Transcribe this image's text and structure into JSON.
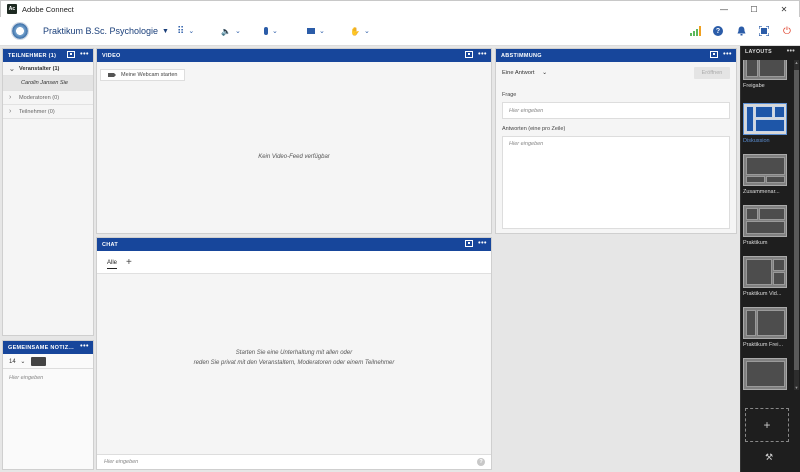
{
  "window": {
    "app_icon_text": "Ac",
    "title": "Adobe Connect",
    "controls": [
      "—",
      "☐",
      "✕"
    ]
  },
  "toolbar": {
    "room_title": "Praktikum B.Sc. Psychologie",
    "icons": {
      "apps": "⠿",
      "speaker": "🔈",
      "microphone": "🎤",
      "camera": "■",
      "hand": "✋"
    },
    "right_icons": {
      "connection": "▂▃▅▇",
      "help": "?",
      "notifications": "🔔",
      "fullscreen": "⛶",
      "power": "⏻"
    },
    "accent_color": "#2b5ca8"
  },
  "participants": {
    "header": "TEILNEHMER  (1)",
    "groups": [
      {
        "label": "Veranstalter (1)",
        "expanded": true
      },
      {
        "label": "Moderatoren (0)",
        "expanded": false
      },
      {
        "label": "Teilnehmer (0)",
        "expanded": false
      }
    ],
    "user": "Carolin Jansen  Sie"
  },
  "notes": {
    "header": "GEMEINSAME NOTIZ...",
    "font_size": "14",
    "swatch_color": "#444444",
    "placeholder": "Hier eingeben"
  },
  "video": {
    "header": "VIDEO",
    "webcam_button": "Meine Webcam starten",
    "empty_message": "Kein Video-Feed verfügbar"
  },
  "chat": {
    "header": "CHAT",
    "tab_all": "Alle",
    "add_tab": "+",
    "empty_line1": "Starten Sie eine Unterhaltung mit allen oder",
    "empty_line2": "reden Sie privat mit den Veranstaltern, Moderatoren oder einem Teilnehmer",
    "input_placeholder": "Hier eingeben",
    "help": "?"
  },
  "poll": {
    "header": "ABSTIMMUNG",
    "answer_type": "Eine Antwort",
    "open_button": "Eröffnen",
    "question_label": "Frage",
    "question_placeholder": "Hier eingeben",
    "answers_label": "Antworten (eine pro Zeile)",
    "answers_placeholder": "Hier eingeben"
  },
  "layouts": {
    "header": "LAYOUTS",
    "items": [
      {
        "label": "Freigabe",
        "active": false
      },
      {
        "label": "Diskussion",
        "active": true
      },
      {
        "label": "Zusammenar...",
        "active": false
      },
      {
        "label": "Praktikum",
        "active": false
      },
      {
        "label": "Praktikum Vid...",
        "active": false
      },
      {
        "label": "Praktikum Frei...",
        "active": false
      },
      {
        "label": "",
        "active": false
      }
    ],
    "add": "+",
    "tools": "⚒"
  },
  "header_dots": "•••"
}
